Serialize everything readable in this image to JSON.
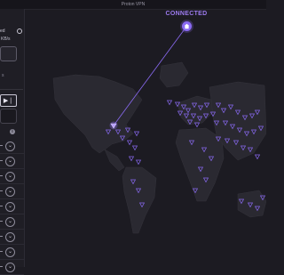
{
  "window": {
    "title": "Proton VPN"
  },
  "sidebar": {
    "status_text": "ed",
    "speed_text": "KB/s",
    "section_label": "s",
    "quick_connect_icon": "skip-forward-icon",
    "rows": 8
  },
  "map": {
    "status_label": "CONNECTED",
    "accent_color": "#8a6af3",
    "server_color": "#8a6af3",
    "land_color": "#2a2931",
    "background_color": "#1c1b22"
  }
}
